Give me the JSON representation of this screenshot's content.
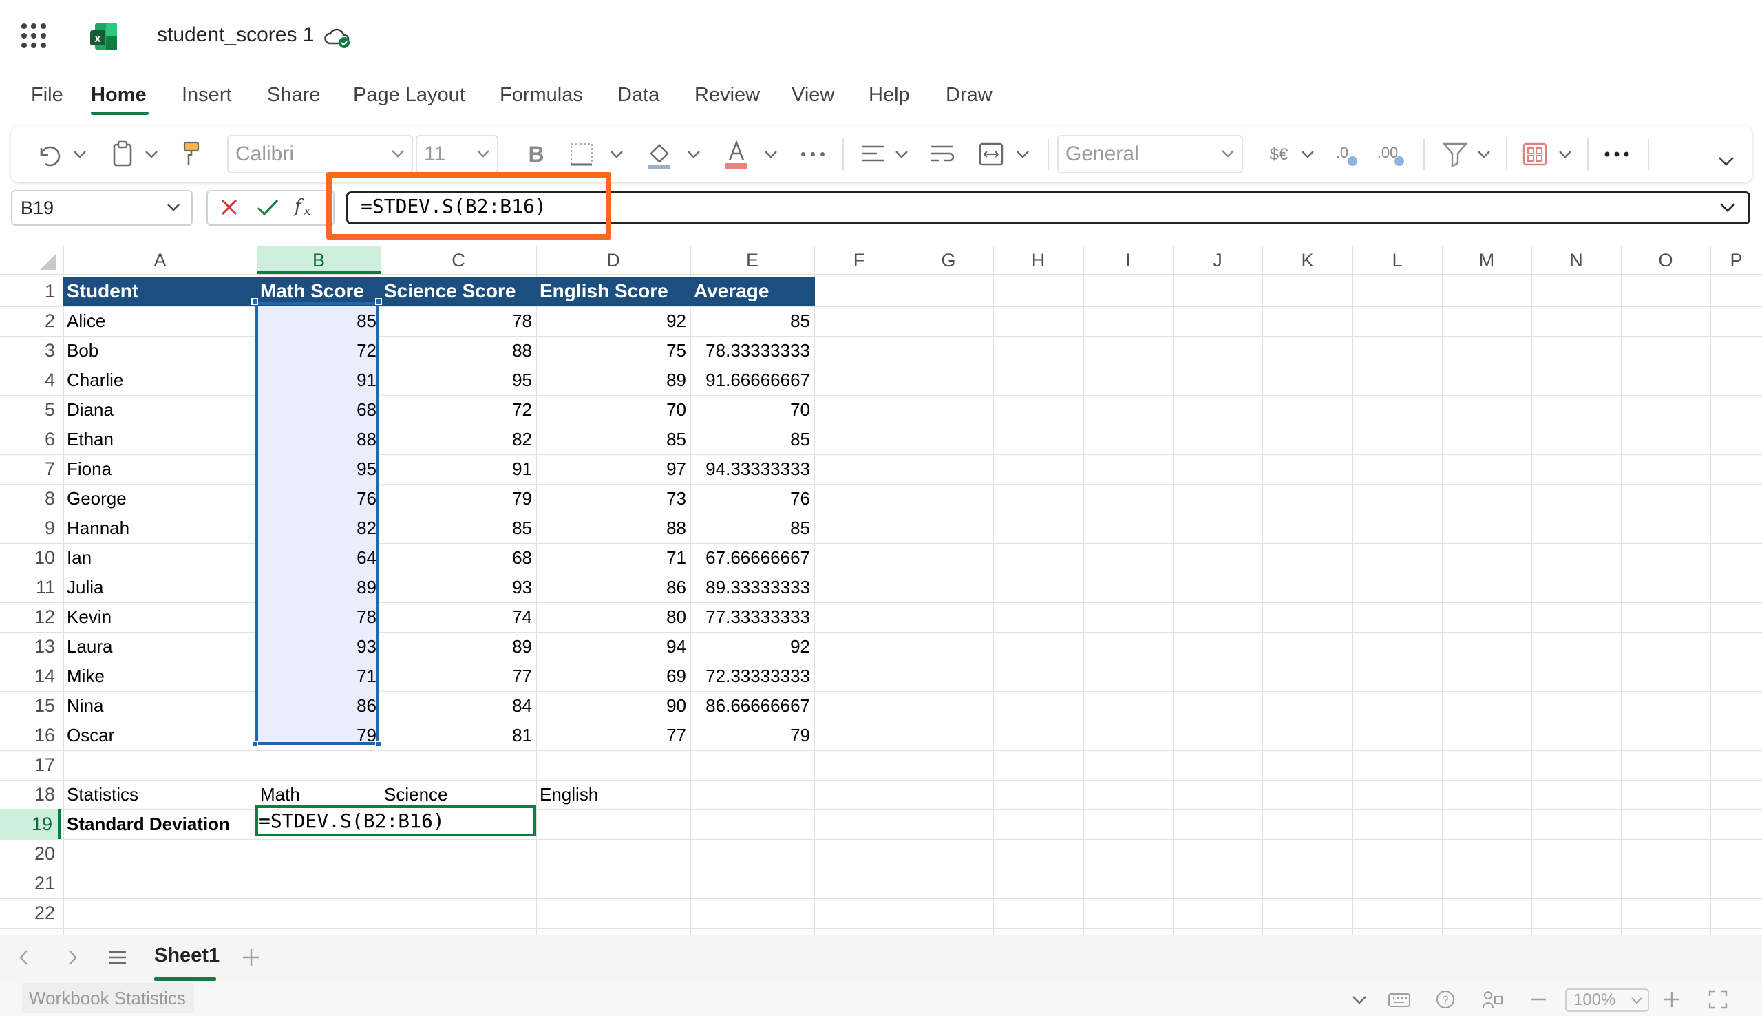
{
  "app": {
    "document_title": "student_scores 1",
    "icons": [
      "app-launcher-icon",
      "excel-logo-icon",
      "cloud-saved-icon"
    ]
  },
  "menu": {
    "tabs": [
      "File",
      "Home",
      "Insert",
      "Share",
      "Page Layout",
      "Formulas",
      "Data",
      "Review",
      "View",
      "Help",
      "Draw"
    ],
    "active": "Home"
  },
  "ribbon": {
    "font_name": "Calibri",
    "font_size": "11",
    "number_format": "General"
  },
  "formula_bar": {
    "name_box": "B19",
    "formula": "=STDEV.S(B2:B16)"
  },
  "grid": {
    "columns": [
      "A",
      "B",
      "C",
      "D",
      "E",
      "F",
      "G",
      "H",
      "I",
      "J",
      "K",
      "L",
      "M",
      "N",
      "O",
      "P"
    ],
    "rows": [
      "1",
      "2",
      "3",
      "4",
      "5",
      "6",
      "7",
      "8",
      "9",
      "10",
      "11",
      "12",
      "13",
      "14",
      "15",
      "16",
      "17",
      "18",
      "19",
      "20",
      "21",
      "22"
    ],
    "selected_column": "B",
    "selected_row": "19",
    "header": [
      "Student",
      "Math Score",
      "Science Score",
      "English Score",
      "Average"
    ],
    "data": [
      [
        "Alice",
        "85",
        "78",
        "92",
        "85"
      ],
      [
        "Bob",
        "72",
        "88",
        "75",
        "78.33333333"
      ],
      [
        "Charlie",
        "91",
        "95",
        "89",
        "91.66666667"
      ],
      [
        "Diana",
        "68",
        "72",
        "70",
        "70"
      ],
      [
        "Ethan",
        "88",
        "82",
        "85",
        "85"
      ],
      [
        "Fiona",
        "95",
        "91",
        "97",
        "94.33333333"
      ],
      [
        "George",
        "76",
        "79",
        "73",
        "76"
      ],
      [
        "Hannah",
        "82",
        "85",
        "88",
        "85"
      ],
      [
        "Ian",
        "64",
        "68",
        "71",
        "67.66666667"
      ],
      [
        "Julia",
        "89",
        "93",
        "86",
        "89.33333333"
      ],
      [
        "Kevin",
        "78",
        "74",
        "80",
        "77.33333333"
      ],
      [
        "Laura",
        "93",
        "89",
        "94",
        "92"
      ],
      [
        "Mike",
        "71",
        "77",
        "69",
        "72.33333333"
      ],
      [
        "Nina",
        "86",
        "84",
        "90",
        "86.66666667"
      ],
      [
        "Oscar",
        "79",
        "81",
        "77",
        "79"
      ]
    ],
    "row18": [
      "Statistics",
      "Math",
      "Science",
      "English"
    ],
    "row19_label": "Standard Deviation",
    "editing_value": "=STDEV.S(B2:B16)"
  },
  "sheets": {
    "tabs": [
      "Sheet1"
    ],
    "active": "Sheet1"
  },
  "status": {
    "workbook_statistics": "Workbook Statistics",
    "zoom": "100%"
  },
  "colors": {
    "accent": "#107c41",
    "header_fill": "#1d4e80",
    "selection": "#1e66b4",
    "annotation": "#f36b21"
  }
}
